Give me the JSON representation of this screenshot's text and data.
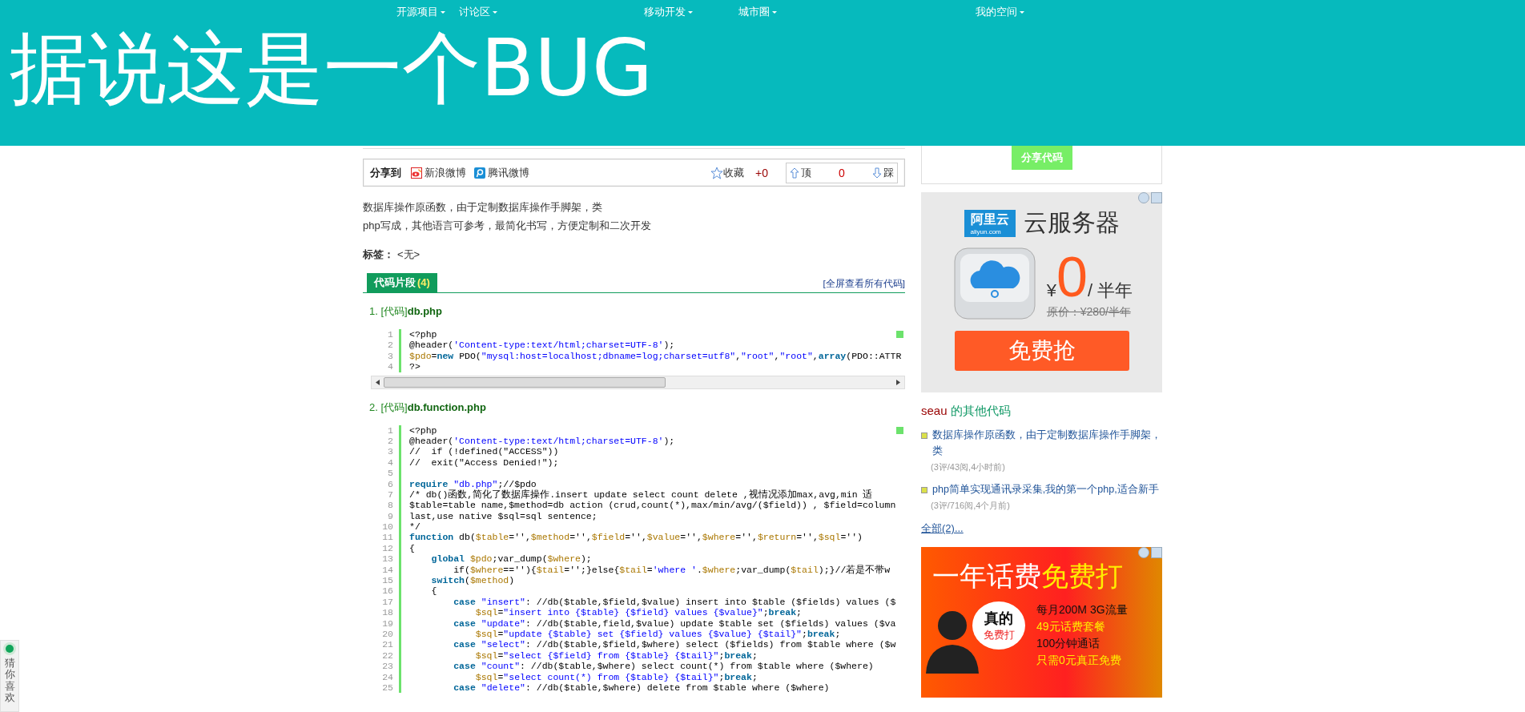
{
  "nav": [
    {
      "label": "开源项目",
      "dropdown": true
    },
    {
      "label": "讨论区",
      "dropdown": true
    },
    {
      "label": "移动开发",
      "dropdown": true
    },
    {
      "label": "城市圈",
      "dropdown": true
    },
    {
      "label": "我的空间",
      "dropdown": true
    }
  ],
  "caption": "据说这是一个BUG",
  "share_bar": {
    "label": "分享到",
    "services": [
      {
        "kind": "sina",
        "label": "新浪微博"
      },
      {
        "kind": "tencent",
        "label": "腾讯微博"
      }
    ],
    "favorite": "收藏",
    "favorite_count": "+0",
    "vote": {
      "up": "顶",
      "count": "0",
      "down": "踩"
    }
  },
  "description": [
    "数据库操作原函数，由于定制数据库操作手脚架，类",
    "php写成，其他语言可参考，最简化书写，方便定制和二次开发"
  ],
  "tags": {
    "label": "标签：",
    "value": "<无>"
  },
  "snippets_tab": {
    "label": "代码片段",
    "count": "(4)",
    "link": "[全屏查看所有代码]"
  },
  "snippets": [
    {
      "title": "1. [代码]**db.php**",
      "scrollbar": true,
      "lines": [
        {
          "number": "1",
          "parts": [
            {
              "kind": "plain",
              "text": "<?php"
            }
          ]
        },
        {
          "number": "2",
          "parts": [
            {
              "kind": "plain",
              "text": "@header("
            },
            {
              "kind": "str",
              "text": "'Content-type:text/html;charset=UTF-8'"
            },
            {
              "kind": "plain",
              "text": ");"
            }
          ]
        },
        {
          "number": "3",
          "parts": [
            {
              "kind": "var",
              "text": "$pdo"
            },
            {
              "kind": "plain",
              "text": "="
            },
            {
              "kind": "kw",
              "text": "new"
            },
            {
              "kind": "plain",
              "text": " PDO("
            },
            {
              "kind": "str",
              "text": "\"mysql:host=localhost;dbname=log;charset=utf8\""
            },
            {
              "kind": "plain",
              "text": ","
            },
            {
              "kind": "str",
              "text": "\"root\""
            },
            {
              "kind": "plain",
              "text": ","
            },
            {
              "kind": "str",
              "text": "\"root\""
            },
            {
              "kind": "plain",
              "text": ","
            },
            {
              "kind": "kw",
              "text": "array"
            },
            {
              "kind": "plain",
              "text": "(PDO::ATTR"
            }
          ]
        },
        {
          "number": "4",
          "parts": [
            {
              "kind": "plain",
              "text": "?>"
            }
          ]
        }
      ]
    },
    {
      "title": "2. [代码]**db.function.php**",
      "scrollbar": false,
      "lines": [
        {
          "number": "1",
          "parts": [
            {
              "kind": "plain",
              "text": "<?php"
            }
          ]
        },
        {
          "number": "2",
          "parts": [
            {
              "kind": "plain",
              "text": "@header("
            },
            {
              "kind": "str",
              "text": "'Content-type:text/html;charset=UTF-8'"
            },
            {
              "kind": "plain",
              "text": ");"
            }
          ]
        },
        {
          "number": "3",
          "parts": [
            {
              "kind": "plain",
              "text": "//  if (!defined(\"ACCESS\"))"
            }
          ]
        },
        {
          "number": "4",
          "parts": [
            {
              "kind": "plain",
              "text": "//  exit(\"Access Denied!\");"
            }
          ]
        },
        {
          "number": "5"
        },
        {
          "number": "6",
          "parts": [
            {
              "kind": "kw",
              "text": "require"
            },
            {
              "kind": "str",
              "text": " \"db.php\""
            },
            {
              "kind": "plain",
              "text": ";//$pdo"
            }
          ]
        },
        {
          "number": "7",
          "parts": [
            {
              "kind": "plain",
              "text": "/* db()函数,简化了数据库操作.insert update select count delete ,视情况添加max,avg,min 适"
            }
          ]
        },
        {
          "number": "8",
          "parts": [
            {
              "kind": "plain",
              "text": "$table=table name,$method=db action (crud,count(*),max/min/avg/($field)) , $field=column"
            }
          ]
        },
        {
          "number": "9",
          "parts": [
            {
              "kind": "plain",
              "text": "last,use native $sql=sql sentence;"
            }
          ]
        },
        {
          "number": "10",
          "parts": [
            {
              "kind": "plain",
              "text": "*/"
            }
          ]
        },
        {
          "number": "11",
          "parts": [
            {
              "kind": "kw",
              "text": "function"
            },
            {
              "kind": "plain",
              "text": " db("
            },
            {
              "kind": "var",
              "text": "$table"
            },
            {
              "kind": "plain",
              "text": "='',"
            },
            {
              "kind": "var",
              "text": "$method"
            },
            {
              "kind": "plain",
              "text": "='',"
            },
            {
              "kind": "var",
              "text": "$field"
            },
            {
              "kind": "plain",
              "text": "='',"
            },
            {
              "kind": "var",
              "text": "$value"
            },
            {
              "kind": "plain",
              "text": "='',"
            },
            {
              "kind": "var",
              "text": "$where"
            },
            {
              "kind": "plain",
              "text": "='',"
            },
            {
              "kind": "var",
              "text": "$return"
            },
            {
              "kind": "plain",
              "text": "='',"
            },
            {
              "kind": "var",
              "text": "$sql"
            },
            {
              "kind": "plain",
              "text": "='')"
            }
          ]
        },
        {
          "number": "12",
          "parts": [
            {
              "kind": "plain",
              "text": "{"
            }
          ]
        },
        {
          "number": "13",
          "parts": [
            {
              "kind": "kw",
              "text": "    global"
            },
            {
              "kind": "var",
              "text": " $pdo"
            },
            {
              "kind": "plain",
              "text": ";var_dump("
            },
            {
              "kind": "var",
              "text": "$where"
            },
            {
              "kind": "plain",
              "text": ");"
            }
          ]
        },
        {
          "number": "14",
          "parts": [
            {
              "kind": "plain",
              "text": "        if("
            },
            {
              "kind": "var",
              "text": "$where"
            },
            {
              "kind": "plain",
              "text": "==''){"
            },
            {
              "kind": "var",
              "text": "$tail"
            },
            {
              "kind": "plain",
              "text": "='';}else{"
            },
            {
              "kind": "var",
              "text": "$tail"
            },
            {
              "kind": "plain",
              "text": "="
            },
            {
              "kind": "str",
              "text": "'where '"
            },
            {
              "kind": "plain",
              "text": "."
            },
            {
              "kind": "var",
              "text": "$where"
            },
            {
              "kind": "plain",
              "text": ";var_dump("
            },
            {
              "kind": "var",
              "text": "$tail"
            },
            {
              "kind": "plain",
              "text": ");}//若是不带w"
            }
          ]
        },
        {
          "number": "15",
          "parts": [
            {
              "kind": "kw",
              "text": "    switch"
            },
            {
              "kind": "plain",
              "text": "("
            },
            {
              "kind": "var",
              "text": "$method"
            },
            {
              "kind": "plain",
              "text": ")"
            }
          ]
        },
        {
          "number": "16",
          "parts": [
            {
              "kind": "plain",
              "text": "    {"
            }
          ]
        },
        {
          "number": "17",
          "parts": [
            {
              "kind": "kw",
              "text": "        case"
            },
            {
              "kind": "str",
              "text": " \"insert\""
            },
            {
              "kind": "plain",
              "text": ": //db($table,$field,$value) insert into $table ($fields) values ($"
            }
          ]
        },
        {
          "number": "18",
          "parts": [
            {
              "kind": "var",
              "text": "            $sql"
            },
            {
              "kind": "plain",
              "text": "="
            },
            {
              "kind": "str",
              "text": "\"insert into {$table} {$field} values {$value}\""
            },
            {
              "kind": "plain",
              "text": ";"
            },
            {
              "kind": "kw",
              "text": "break"
            },
            {
              "kind": "plain",
              "text": ";"
            }
          ]
        },
        {
          "number": "19",
          "parts": [
            {
              "kind": "kw",
              "text": "        case"
            },
            {
              "kind": "str",
              "text": " \"update\""
            },
            {
              "kind": "plain",
              "text": ": //db($table,field,$value) update $table set ($fields) values ($va"
            }
          ]
        },
        {
          "number": "20",
          "parts": [
            {
              "kind": "var",
              "text": "            $sql"
            },
            {
              "kind": "plain",
              "text": "="
            },
            {
              "kind": "str",
              "text": "\"update {$table} set {$field} values {$value} {$tail}\""
            },
            {
              "kind": "plain",
              "text": ";"
            },
            {
              "kind": "kw",
              "text": "break"
            },
            {
              "kind": "plain",
              "text": ";"
            }
          ]
        },
        {
          "number": "21",
          "parts": [
            {
              "kind": "kw",
              "text": "        case"
            },
            {
              "kind": "str",
              "text": " \"select\""
            },
            {
              "kind": "plain",
              "text": ": //db($table,$field,$where) select ($fields) from $table where ($w"
            }
          ]
        },
        {
          "number": "22",
          "parts": [
            {
              "kind": "var",
              "text": "            $sql"
            },
            {
              "kind": "plain",
              "text": "="
            },
            {
              "kind": "str",
              "text": "\"select {$field} from {$table} {$tail}\""
            },
            {
              "kind": "plain",
              "text": ";"
            },
            {
              "kind": "kw",
              "text": "break"
            },
            {
              "kind": "plain",
              "text": ";"
            }
          ]
        },
        {
          "number": "23",
          "parts": [
            {
              "kind": "kw",
              "text": "        case"
            },
            {
              "kind": "str",
              "text": " \"count\""
            },
            {
              "kind": "plain",
              "text": ": //db($table,$where) select count(*) from $table where ($where)"
            }
          ]
        },
        {
          "number": "24",
          "parts": [
            {
              "kind": "var",
              "text": "            $sql"
            },
            {
              "kind": "plain",
              "text": "="
            },
            {
              "kind": "str",
              "text": "\"select count(*) from {$table} {$tail}\""
            },
            {
              "kind": "plain",
              "text": ";"
            },
            {
              "kind": "kw",
              "text": "break"
            },
            {
              "kind": "plain",
              "text": ";"
            }
          ]
        },
        {
          "number": "25",
          "parts": [
            {
              "kind": "kw",
              "text": "        case"
            },
            {
              "kind": "str",
              "text": " \"delete\""
            },
            {
              "kind": "plain",
              "text": ": //db($table,$where) delete from $table where ($where)"
            }
          ]
        }
      ]
    }
  ],
  "sidebar": {
    "share_code_button": "分享代码",
    "ad_cloud": {
      "logo": "阿里云",
      "logo_sub": "aliyun.com",
      "headline": "云服务器",
      "currency": "¥",
      "price": "0",
      "period": "/ 半年",
      "original_price": "原价：¥280/半年",
      "cta": "免费抢"
    },
    "other_code": {
      "user": "seau",
      "heading": "的其他代码",
      "items": [
        {
          "title": "数据库操作原函数，由于定制数据库操作手脚架，类",
          "meta": "(3评/43阅,4小时前)"
        },
        {
          "title": "php简单实现通讯录采集,我的第一个php,适合新手",
          "meta": "(3评/716阅,4个月前)"
        }
      ],
      "more": "全部(2)..."
    },
    "ad_phone": {
      "headline": "一年话费",
      "headline_highlight": "免费打",
      "bubble": [
        "真的",
        "免费打"
      ],
      "lines": [
        {
          "text": "每月200M 3G流量",
          "highlight": false
        },
        {
          "text": "49元话费套餐",
          "highlight": true
        },
        {
          "text": "100分钟通话",
          "highlight": false
        },
        {
          "text": "只需0元真正免费",
          "highlight": true
        }
      ]
    }
  },
  "side_widget": {
    "label": "猜你喜欢"
  }
}
